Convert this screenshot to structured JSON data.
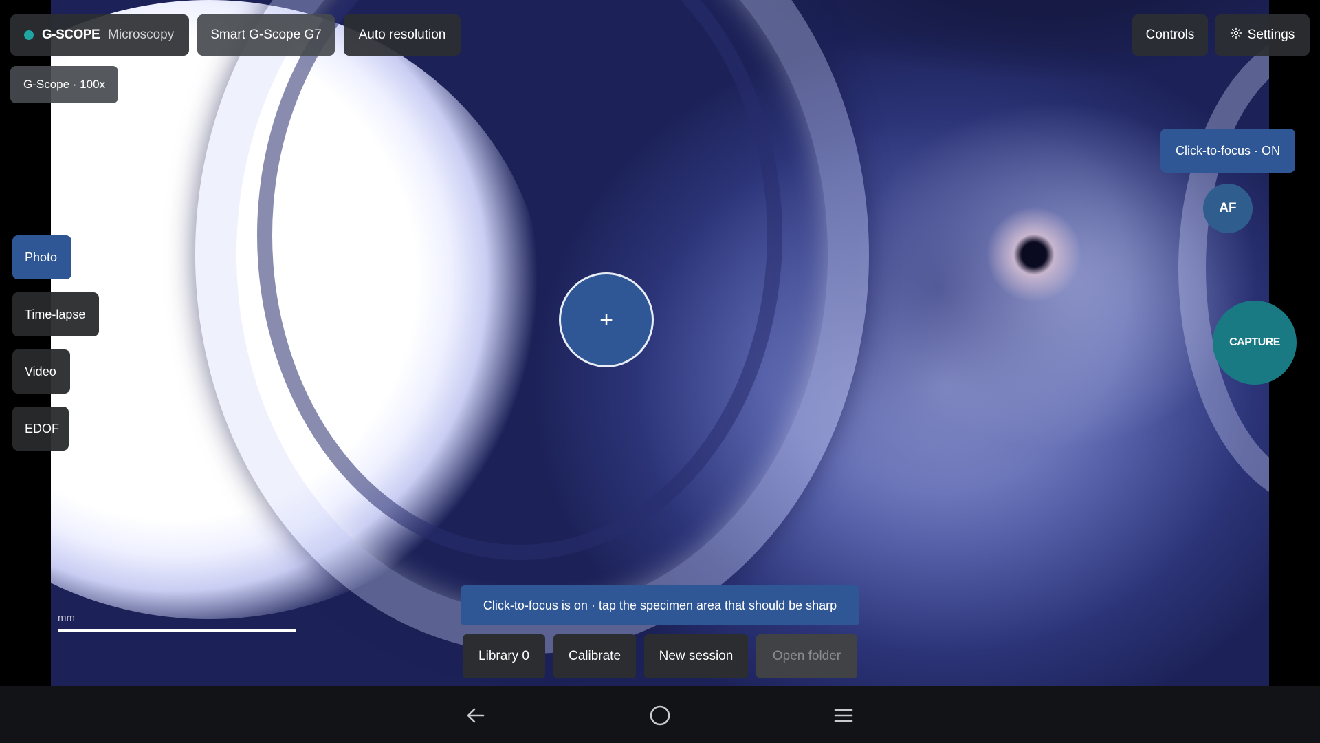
{
  "topbar": {
    "brand_name": "G-SCOPE",
    "brand_sub": "Microscopy",
    "device": "Smart G-Scope G7",
    "resolution": "Auto resolution",
    "scope_info": "G-Scope · 100x",
    "controls_label": "Controls",
    "settings_label": "Settings"
  },
  "modes": {
    "photo": "Photo",
    "timelapse": "Time-lapse",
    "video": "Video",
    "edof": "EDOF",
    "selected": "Photo"
  },
  "right_panel": {
    "focus_badge": "Click-to-focus · ON",
    "af_label": "AF",
    "capture_label": "CAPTURE"
  },
  "viewport": {
    "reticle_symbol": "+",
    "scale_label": "mm"
  },
  "hint": "Click-to-focus is on · tap the specimen area that should be sharp",
  "actions": {
    "library": "Library 0",
    "calibrate": "Calibrate",
    "new_session": "New session",
    "open_folder": "Open folder"
  },
  "colors": {
    "accent_blue": "#2f5695",
    "capture_teal": "#1a7a84",
    "status_dot": "#1fa6a3"
  },
  "icons": {
    "settings": "gear-icon",
    "back": "back-arrow-icon",
    "home": "home-circle-icon",
    "recents": "menu-lines-icon"
  }
}
